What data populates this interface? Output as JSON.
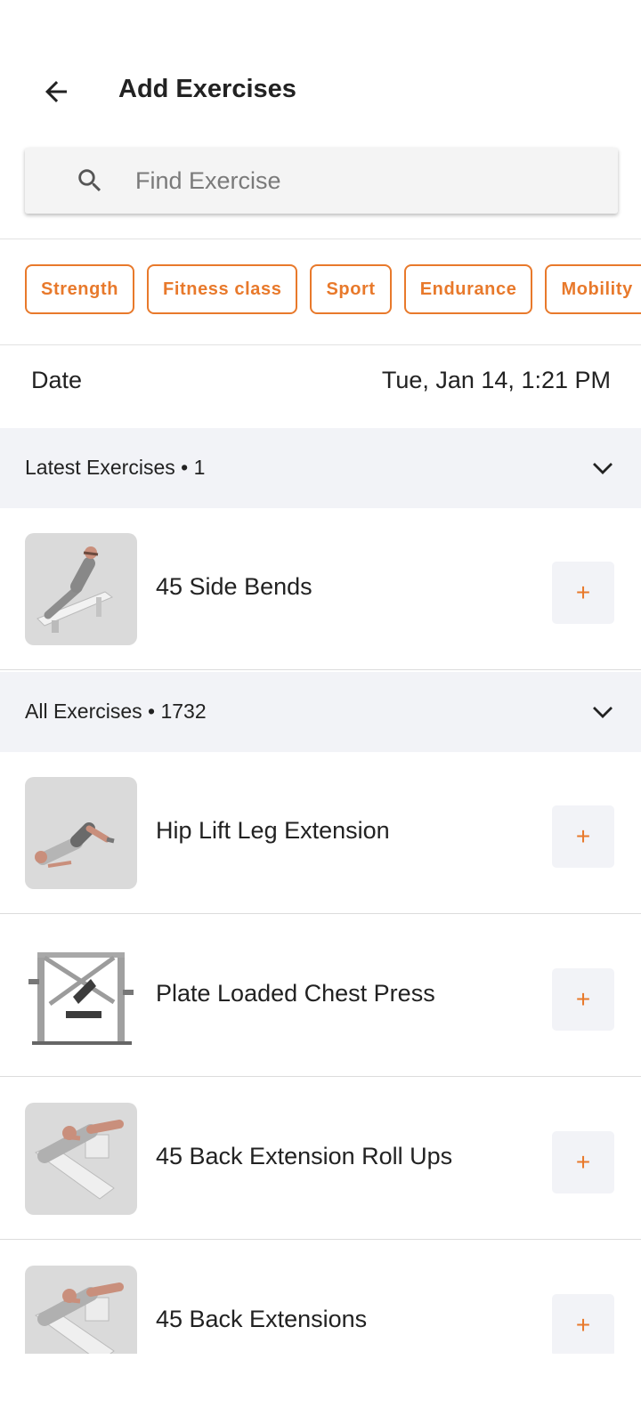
{
  "header": {
    "title": "Add Exercises",
    "back_icon": "arrow-left-icon"
  },
  "search": {
    "placeholder": "Find Exercise",
    "value": "",
    "icon": "search-icon"
  },
  "filters": [
    "Strength",
    "Fitness class",
    "Sport",
    "Endurance",
    "Mobility"
  ],
  "date": {
    "label": "Date",
    "value": "Tue, Jan 14, 1:21 PM"
  },
  "latest": {
    "title": "Latest Exercises • 1",
    "items": [
      {
        "name": "45 Side Bends",
        "add_label": "+"
      }
    ]
  },
  "all": {
    "title": "All Exercises • 1732",
    "items": [
      {
        "name": "Hip Lift Leg Extension",
        "add_label": "+"
      },
      {
        "name": "Plate Loaded Chest Press",
        "add_label": "+"
      },
      {
        "name": "45 Back Extension Roll Ups",
        "add_label": "+"
      },
      {
        "name": "45 Back Extensions",
        "add_label": "+"
      }
    ]
  },
  "colors": {
    "accent": "#e8792b",
    "section_bg": "#f2f3f7"
  }
}
